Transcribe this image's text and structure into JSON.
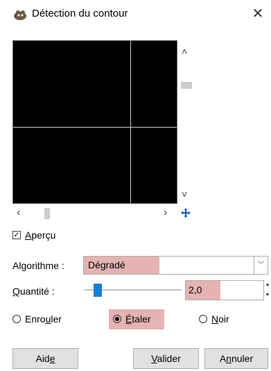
{
  "window": {
    "title": "Détection du contour",
    "close_icon": "close-icon"
  },
  "preview": {
    "checkbox_label_prefix": "",
    "checkbox_label_underlined": "A",
    "checkbox_label_rest": "perçu",
    "checked": true
  },
  "algorithm": {
    "label_prefix": "Al",
    "label_underlined": "g",
    "label_rest": "orithme :",
    "value": "Dégradé"
  },
  "quantity": {
    "label_underlined": "Q",
    "label_rest": "uantité :",
    "value": "2,0",
    "slider_fraction": 0.13
  },
  "radios": {
    "wrap": {
      "prefix": "Enro",
      "underlined": "u",
      "rest": "ler",
      "selected": false
    },
    "smear": {
      "underlined": "É",
      "rest": "taler",
      "selected": true
    },
    "black": {
      "underlined": "N",
      "rest": "oir",
      "selected": false
    }
  },
  "buttons": {
    "help": {
      "prefix": "Aid",
      "underlined": "e"
    },
    "ok": {
      "underlined": "V",
      "rest": "alider"
    },
    "cancel": {
      "prefix": "A",
      "underlined": "n",
      "rest": "nuler"
    }
  },
  "colors": {
    "highlight": "#e5b3b3",
    "slider_thumb": "#1b7ed6",
    "preview_bg": "#000000",
    "guides": "#cfcfcf"
  }
}
